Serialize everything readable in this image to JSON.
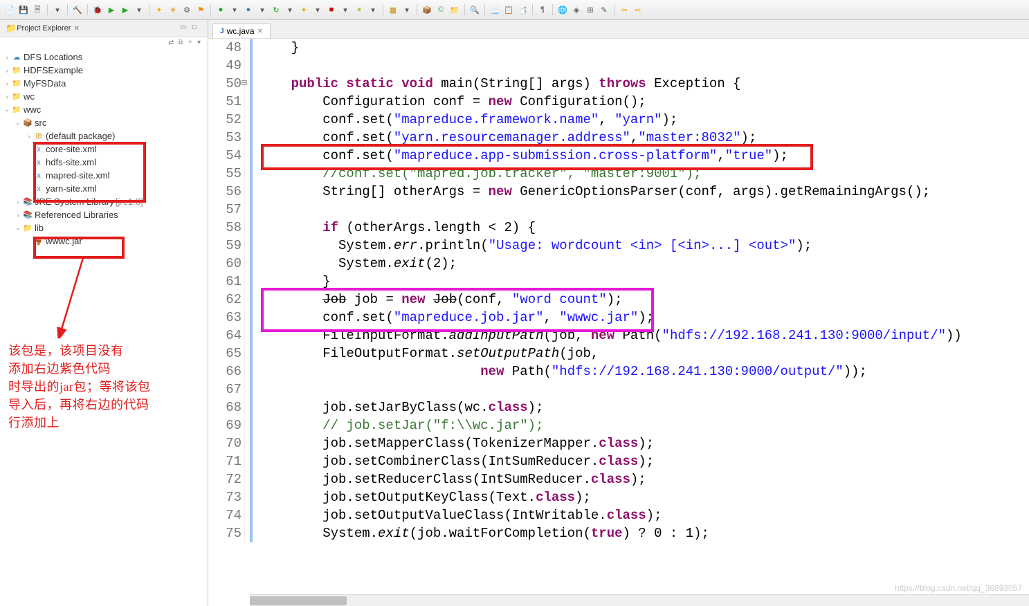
{
  "explorer": {
    "title": "Project Explorer",
    "items": {
      "dfs": "DFS Locations",
      "hdfs": "HDFSExample",
      "myfs": "MyFSData",
      "wc": "wc",
      "wwc": "wwc",
      "src": "src",
      "defpkg": "(default package)",
      "coresite": "core-site.xml",
      "hdfssite": "hdfs-site.xml",
      "mapredsite": "mapred-site.xml",
      "yarnsite": "yarn-site.xml",
      "jre": "JRE System Library",
      "jrever": " [jre1.8]",
      "reflib": "Referenced Libraries",
      "lib": "lib",
      "wwwcjar": "wwwc.jar"
    }
  },
  "editor": {
    "tab": "wc.java"
  },
  "lines": {
    "48": "    }",
    "49": "",
    "50": "    public static void main(String[] args) throws Exception {",
    "51": "        Configuration conf = new Configuration();",
    "52": "        conf.set(\"mapreduce.framework.name\", \"yarn\");",
    "53": "        conf.set(\"yarn.resourcemanager.address\",\"master:8032\");",
    "54": "        conf.set(\"mapreduce.app-submission.cross-platform\",\"true\");",
    "55": "        //conf.set(\"mapred.job.tracker\", \"master:9001\");",
    "56": "        String[] otherArgs = new GenericOptionsParser(conf, args).getRemainingArgs();",
    "57": "",
    "58": "        if (otherArgs.length < 2) {",
    "59": "          System.err.println(\"Usage: wordcount <in> [<in>...] <out>\");",
    "60": "          System.exit(2);",
    "61": "        }",
    "62": "        Job job = new Job(conf, \"word count\");",
    "63": "        conf.set(\"mapreduce.job.jar\", \"wwwc.jar\");",
    "64": "        FileInputFormat.addInputPath(job, new Path(\"hdfs://192.168.241.130:9000/input/\"))",
    "65": "        FileOutputFormat.setOutputPath(job,",
    "66": "                            new Path(\"hdfs://192.168.241.130:9000/output/\"));",
    "67": "",
    "68": "        job.setJarByClass(wc.class);",
    "69": "        // job.setJar(\"f:\\\\wc.jar\");",
    "70": "        job.setMapperClass(TokenizerMapper.class);",
    "71": "        job.setCombinerClass(IntSumReducer.class);",
    "72": "        job.setReducerClass(IntSumReducer.class);",
    "73": "        job.setOutputKeyClass(Text.class);",
    "74": "        job.setOutputValueClass(IntWritable.class);",
    "75": "        System.exit(job.waitForCompletion(true) ? 0 : 1);"
  },
  "annotation": {
    "l1": "该包是，该项目没有",
    "l2": "添加右边紫色代码",
    "l3": "时导出的jar包；等将该包",
    "l4": "导入后，再将右边的代码",
    "l5": "行添加上"
  },
  "watermark": "https://blog.csdn.net/qq_36893057"
}
